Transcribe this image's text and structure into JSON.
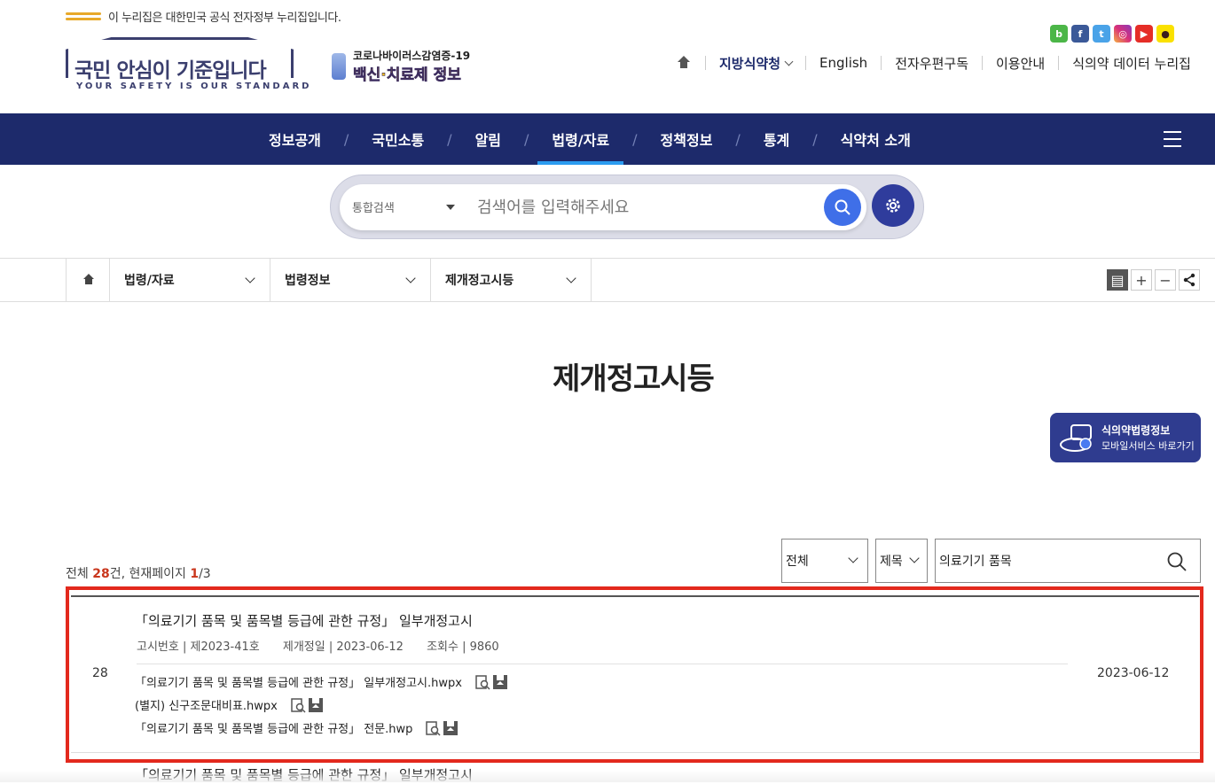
{
  "gov_notice": "이 누리집은 대한민국 공식 전자정부 누리집입니다.",
  "logo": {
    "main": "국민 안심이 기준입니다",
    "sub": "YOUR SAFETY IS OUR STANDARD"
  },
  "covid_banner": {
    "line1": "코로나바이러스감염증-19",
    "line2": "백신·치료제 정보"
  },
  "social_icons": [
    "blog-icon",
    "facebook-icon",
    "twitter-icon",
    "instagram-icon",
    "youtube-icon",
    "kakao-icon"
  ],
  "util_nav": {
    "local": "지방식약청",
    "english": "English",
    "newsletter": "전자우편구독",
    "guide": "이용안내",
    "data": "식의약 데이터 누리집"
  },
  "gnb": {
    "items": [
      "정보공개",
      "국민소통",
      "알림",
      "법령/자료",
      "정책정보",
      "통계",
      "식약처 소개"
    ],
    "separator": "/",
    "active": "법령/자료"
  },
  "search": {
    "scope": "통합검색",
    "placeholder": "검색어를 입력해주세요"
  },
  "breadcrumb": [
    "법령/자료",
    "법령정보",
    "제개정고시등"
  ],
  "page_title": "제개정고시등",
  "mobile_banner": {
    "line1": "식의약법령정보",
    "line2": "모바일서비스 바로가기"
  },
  "list": {
    "count_prefix": "전체 ",
    "total": "28",
    "count_mid": "건, 현재페이지 ",
    "current_page": "1",
    "page_suffix": "/3",
    "filter_category": "전체",
    "filter_field": "제목",
    "query": "의료기기 품목"
  },
  "rows": [
    {
      "num": "28",
      "title": "「의료기기 품목 및 품목별 등급에 관한 규정」 일부개정고시",
      "notice_no": "고시번호 | 제2023-41호",
      "revision_date": "제개정일 | 2023-06-12",
      "views": "조회수 | 9860",
      "files": [
        "「의료기기 품목 및 품목별 등급에 관한 규정」 일부개정고시.hwpx",
        "(별지) 신구조문대비표.hwpx",
        "「의료기기 품목 및 품목별 등급에 관한 규정」 전문.hwp"
      ],
      "date": "2023-06-12"
    },
    {
      "title": "「의료기기 품목 및 품목별 등급에 관한 규정」 일부개정고시"
    }
  ],
  "colors": {
    "navy": "#1d2a6b",
    "accent_blue": "#3f6fe8",
    "highlight_red": "#e3291d",
    "count_red": "#c9361c"
  }
}
